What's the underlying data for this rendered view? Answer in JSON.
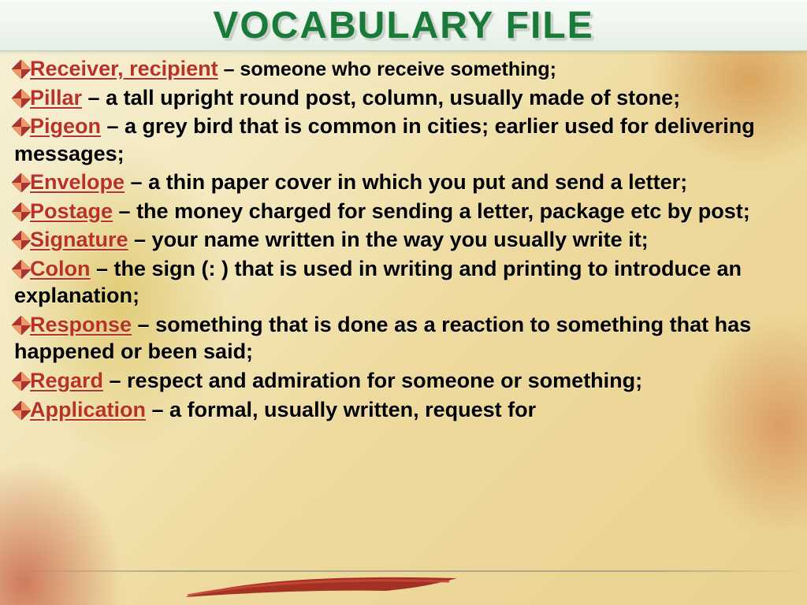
{
  "title": "VOCABULARY FILE",
  "entries": [
    {
      "term": "Receiver, recipient",
      "def": " – someone who receive something;"
    },
    {
      "term": "Pillar",
      "def": " – a tall upright round post, column, usually made of stone;"
    },
    {
      "term": "Pigeon",
      "def": " – a grey bird that is common in cities; earlier used for delivering messages;"
    },
    {
      "term": "Envelope",
      "def": " – a thin paper cover in which you put and send a letter;"
    },
    {
      "term": "Postage",
      "def": " – the money charged for sending a letter, package etc by post;"
    },
    {
      "term": "Signature",
      "def": " – your name written in the way you usually write it;"
    },
    {
      "term": "Colon",
      "def": "  –  the sign (: ) that is used in writing and printing to introduce an explanation;"
    },
    {
      "term": "Response",
      "def": " – something that is done as a reaction to something that has happened or been said;"
    },
    {
      "term": "Regard",
      "def": " – respect and admiration for someone or something;"
    },
    {
      "term": "Application",
      "def": " – a formal, usually written, request for"
    }
  ]
}
